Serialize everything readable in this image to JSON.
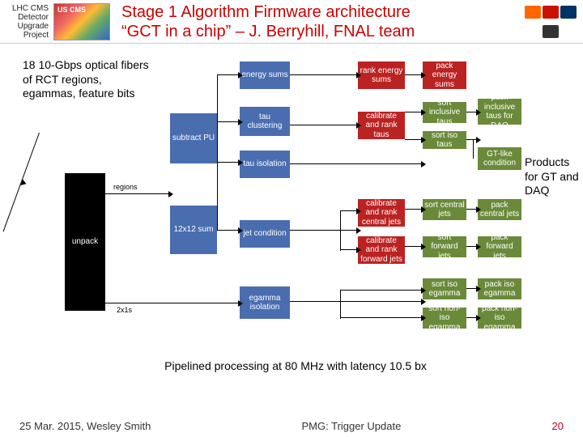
{
  "header": {
    "project_label": "LHC CMS Detector Upgrade Project",
    "title_line1": "Stage 1 Algorithm Firmware architecture",
    "title_line2": "“GCT in a chip” – J. Berryhill, FNAL team"
  },
  "annotations": {
    "left": "18 10-Gbps optical fibers of RCT regions, egammas, feature bits",
    "right": "Products for GT and DAQ",
    "bottom": "Pipelined processing at 80 MHz with latency 10.5 bx",
    "regions_label": "regions",
    "twox1s": "2x1s"
  },
  "blocks": {
    "unpack": "unpack",
    "subtract_pu": "subtract PU",
    "energy_sums": "energy sums",
    "tau_clustering": "tau clustering",
    "tau_isolation": "tau isolation",
    "sum12x12": "12x12 sum",
    "jet_condition": "jet condition",
    "egamma_isolation": "egamma isolation",
    "rank_energy_sums": "rank energy sums",
    "pack_energy_sums": "pack energy sums",
    "cal_rank_taus": "calibrate and rank taus",
    "sort_incl_taus": "sort inclusive taus",
    "pack_incl_taus": "pack inclusive taus for DAQ",
    "sort_iso_taus": "sort iso taus",
    "gtlike_cond": "GT-like condition",
    "cal_rank_cjets": "calibrate and rank central jets",
    "sort_cjets": "sort central jets",
    "pack_cjets": "pack central jets",
    "cal_rank_fjets": "calibrate and rank forward jets",
    "sort_fjets": "sort forward jets",
    "pack_fjets": "pack forward jets",
    "sort_iso_eg": "sort iso egamma",
    "pack_iso_eg": "pack iso egamma",
    "sort_noniso_eg": "sort non-iso egamma",
    "pack_noniso_eg": "pack non-iso egamma"
  },
  "footer": {
    "left": "25 Mar. 2015, Wesley Smith",
    "center": "PMG: Trigger Update",
    "page": "20"
  }
}
